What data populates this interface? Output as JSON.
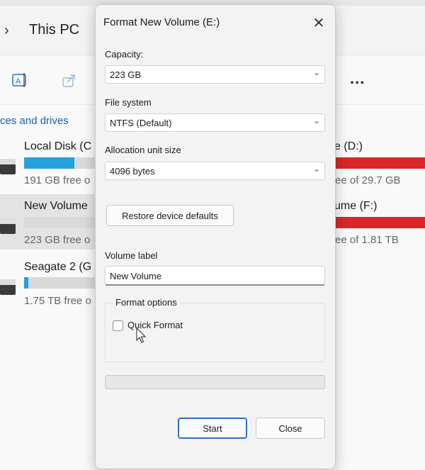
{
  "explorer": {
    "breadcrumb": "This PC",
    "section_title": "ces and drives",
    "drives_left": [
      {
        "name": "Local Disk (C",
        "free": "191 GB free o",
        "usage": 0.7
      },
      {
        "name": "New Volume",
        "free": "223 GB free o",
        "usage": 0.0
      },
      {
        "name": "Seagate 2 (G",
        "free": "1.75 TB free o",
        "usage": 0.06
      }
    ],
    "drives_right": [
      {
        "name": "e (D:)",
        "free": "ree of 29.7 GB",
        "usage": 1.0
      },
      {
        "name": "ume (F:)",
        "free": "ree of 1.81 TB",
        "usage": 1.0
      }
    ],
    "more_label": "..."
  },
  "dialog": {
    "title": "Format New Volume (E:)",
    "capacity_label": "Capacity:",
    "capacity_value": "223 GB",
    "filesystem_label": "File system",
    "filesystem_value": "NTFS (Default)",
    "allocation_label": "Allocation unit size",
    "allocation_value": "4096 bytes",
    "restore_label": "Restore device defaults",
    "volume_label_label": "Volume label",
    "volume_label_value": "New Volume",
    "format_options_label": "Format options",
    "quick_format_label": "Quick Format",
    "quick_format_checked": false,
    "progress": 0,
    "start_label": "Start",
    "close_label": "Close"
  },
  "colors": {
    "accent": "#26a0da",
    "warning_bar": "#da2626",
    "default_button_border": "#2b6fcf"
  }
}
